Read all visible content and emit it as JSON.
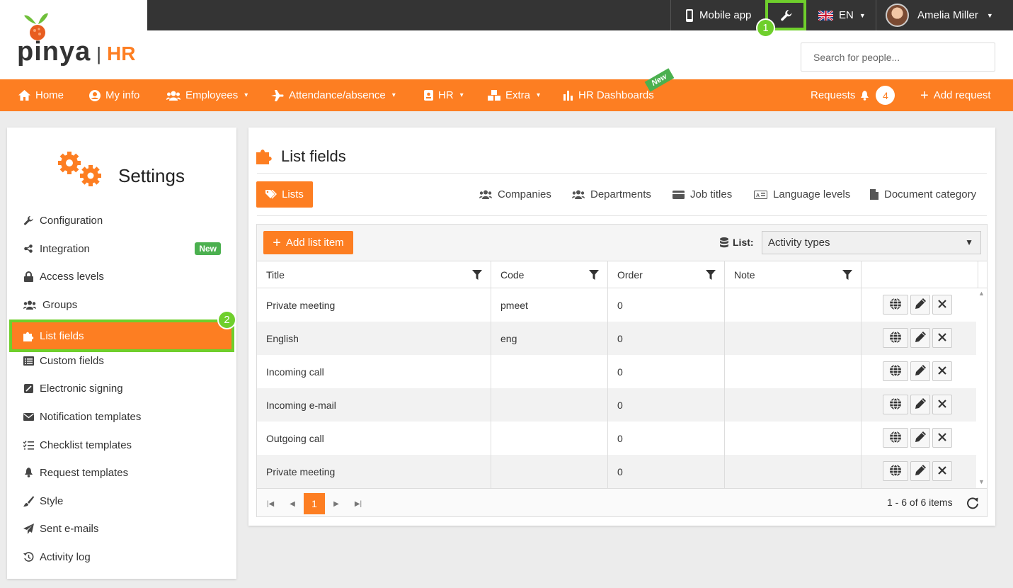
{
  "topbar": {
    "mobile_app": "Mobile app",
    "language": "EN",
    "user_name": "Amelia Miller"
  },
  "logo": {
    "brand": "pinya",
    "suffix": "HR"
  },
  "search": {
    "placeholder": "Search for people..."
  },
  "nav": {
    "items": [
      {
        "label": "Home",
        "icon": "home-icon"
      },
      {
        "label": "My info",
        "icon": "user-circle-icon"
      },
      {
        "label": "Employees",
        "icon": "users-icon"
      },
      {
        "label": "Attendance/absence",
        "icon": "plane-icon"
      },
      {
        "label": "HR",
        "icon": "id-badge-icon"
      },
      {
        "label": "Extra",
        "icon": "cubes-icon"
      },
      {
        "label": "HR Dashboards",
        "icon": "bar-chart-icon"
      }
    ],
    "new_ribbon": "New",
    "requests_label": "Requests",
    "requests_count": "4",
    "add_request": "Add request"
  },
  "sidebar": {
    "title": "Settings",
    "items": [
      {
        "label": "Configuration"
      },
      {
        "label": "Integration",
        "badge": "New"
      },
      {
        "label": "Access levels"
      },
      {
        "label": "Groups"
      },
      {
        "label": "List fields"
      },
      {
        "label": "Custom fields"
      },
      {
        "label": "Electronic signing"
      },
      {
        "label": "Notification templates"
      },
      {
        "label": "Checklist templates"
      },
      {
        "label": "Request templates"
      },
      {
        "label": "Style"
      },
      {
        "label": "Sent e-mails"
      },
      {
        "label": "Activity log"
      }
    ]
  },
  "steps": {
    "one": "1",
    "two": "2"
  },
  "main": {
    "title": "List fields",
    "lists_button": "Lists",
    "tabs": [
      "Companies",
      "Departments",
      "Job titles",
      "Language levels",
      "Document category"
    ],
    "add_button": "Add list item",
    "list_label": "List:",
    "list_value": "Activity types",
    "columns": [
      "Title",
      "Code",
      "Order",
      "Note"
    ],
    "rows": [
      {
        "title": "Private meeting",
        "code": "pmeet",
        "order": "0",
        "note": ""
      },
      {
        "title": "English",
        "code": "eng",
        "order": "0",
        "note": ""
      },
      {
        "title": "Incoming call",
        "code": "",
        "order": "0",
        "note": ""
      },
      {
        "title": "Incoming e-mail",
        "code": "",
        "order": "0",
        "note": ""
      },
      {
        "title": "Outgoing call",
        "code": "",
        "order": "0",
        "note": ""
      },
      {
        "title": "Private meeting",
        "code": "",
        "order": "0",
        "note": ""
      }
    ],
    "pager": {
      "current": "1",
      "info": "1 - 6 of 6 items"
    }
  },
  "colors": {
    "accent": "#fd7e22",
    "topbar": "#343434",
    "highlight": "#6fcf2c",
    "badge_green": "#4bb04f"
  }
}
